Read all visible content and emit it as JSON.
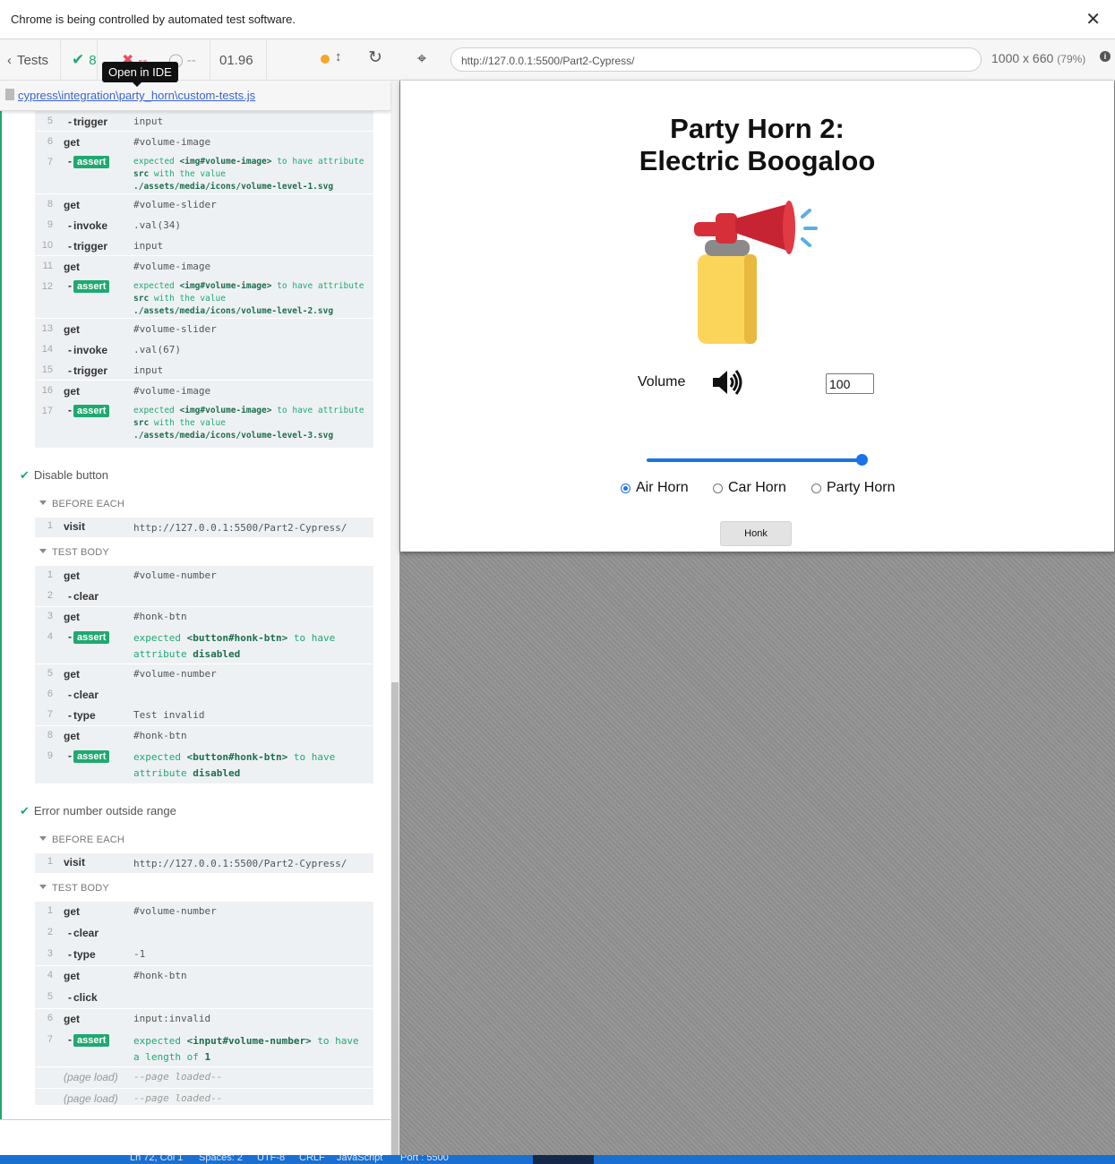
{
  "infobar": {
    "message": "Chrome is being controlled by automated test software.",
    "close": "✕"
  },
  "stats": {
    "tests_label": "Tests",
    "passed": "8",
    "failed": "--",
    "pending": "--",
    "duration": "01.96"
  },
  "tooltip": "Open in IDE",
  "file": {
    "path": "cypress\\integration\\party_horn\\custom-tests.js"
  },
  "commands_top": [
    {
      "num": "5",
      "cmd": "trigger",
      "sub": true,
      "msg": "input"
    },
    {
      "num": "6",
      "cmd": "get",
      "sub": false,
      "msg": "#volume-image"
    },
    {
      "num": "7",
      "assert": true,
      "line1": "expected",
      "el": "<img#volume-image>",
      "line1b": "to have attribute",
      "line2a": "src",
      "line2b": "with the value",
      "line3": "./assets/media/icons/volume-level-1.svg"
    },
    {
      "num": "8",
      "cmd": "get",
      "sub": false,
      "msg": "#volume-slider"
    },
    {
      "num": "9",
      "cmd": "invoke",
      "sub": true,
      "msg": ".val(34)"
    },
    {
      "num": "10",
      "cmd": "trigger",
      "sub": true,
      "msg": "input"
    },
    {
      "num": "11",
      "cmd": "get",
      "sub": false,
      "msg": "#volume-image"
    },
    {
      "num": "12",
      "assert": true,
      "line1": "expected",
      "el": "<img#volume-image>",
      "line1b": "to have attribute",
      "line2a": "src",
      "line2b": "with the value",
      "line3": "./assets/media/icons/volume-level-2.svg"
    },
    {
      "num": "13",
      "cmd": "get",
      "sub": false,
      "msg": "#volume-slider"
    },
    {
      "num": "14",
      "cmd": "invoke",
      "sub": true,
      "msg": ".val(67)"
    },
    {
      "num": "15",
      "cmd": "trigger",
      "sub": true,
      "msg": "input"
    },
    {
      "num": "16",
      "cmd": "get",
      "sub": false,
      "msg": "#volume-image"
    },
    {
      "num": "17",
      "assert": true,
      "line1": "expected",
      "el": "<img#volume-image>",
      "line1b": "to have attribute",
      "line2a": "src",
      "line2b": "with the value",
      "line3": "./assets/media/icons/volume-level-3.svg"
    }
  ],
  "test2": {
    "title": "Disable button",
    "before_each": "BEFORE EACH",
    "test_body": "TEST BODY",
    "visit": {
      "num": "1",
      "cmd": "visit",
      "msg": "http://127.0.0.1:5500/Part2-Cypress/"
    },
    "rows": [
      {
        "num": "1",
        "cmd": "get",
        "msg": "#volume-number"
      },
      {
        "num": "2",
        "cmd": "clear",
        "msg": ""
      },
      {
        "num": "3",
        "cmd": "get",
        "msg": "#honk-btn"
      },
      {
        "num": "4",
        "expected": "expected",
        "el": "<button#honk-btn>",
        "to": "to have",
        "attr": "attribute",
        "val": "disabled"
      },
      {
        "num": "5",
        "cmd": "get",
        "msg": "#volume-number"
      },
      {
        "num": "6",
        "cmd": "clear",
        "msg": ""
      },
      {
        "num": "7",
        "cmd": "type",
        "msg": "Test invalid"
      },
      {
        "num": "8",
        "cmd": "get",
        "msg": "#honk-btn"
      },
      {
        "num": "9",
        "expected": "expected",
        "el": "<button#honk-btn>",
        "to": "to have",
        "attr": "attribute",
        "val": "disabled"
      }
    ]
  },
  "test3": {
    "title": "Error number outside range",
    "before_each": "BEFORE EACH",
    "test_body": "TEST BODY",
    "visit": {
      "num": "1",
      "cmd": "visit",
      "msg": "http://127.0.0.1:5500/Part2-Cypress/"
    },
    "rows": [
      {
        "num": "1",
        "cmd": "get",
        "msg": "#volume-number"
      },
      {
        "num": "2",
        "cmd": "clear",
        "msg": ""
      },
      {
        "num": "3",
        "cmd": "type",
        "msg": "-1"
      },
      {
        "num": "4",
        "cmd": "get",
        "msg": "#honk-btn"
      },
      {
        "num": "5",
        "cmd": "click",
        "msg": ""
      },
      {
        "num": "6",
        "cmd": "get",
        "msg": "input:invalid"
      },
      {
        "num": "7",
        "expected": "expected",
        "el": "<input#volume-number>",
        "to": "to have",
        "attr": "a length of",
        "val": "1"
      },
      {
        "cmd": "(page load)",
        "msg": "--page loaded--"
      },
      {
        "cmd": "(page load)",
        "msg": "--page loaded--"
      }
    ]
  },
  "assert_label": "assert",
  "autbar": {
    "url": "http://127.0.0.1:5500/Part2-Cypress/",
    "viewport": "1000 x 660",
    "scale": "(79%)"
  },
  "app": {
    "title_line1": "Party Horn 2:",
    "title_line2": "Electric Boogaloo",
    "volume_label": "Volume",
    "volume_value": "100",
    "slider_fraction": 1.0,
    "radios": [
      "Air Horn",
      "Car Horn",
      "Party Horn"
    ],
    "selected_radio": "Air Horn",
    "honk": "Honk"
  },
  "taskbar": [
    "Ln 72, Col 1",
    "Spaces: 2",
    "UTF-8",
    "CRLF",
    "JavaScript",
    "Port : 5500"
  ],
  "colors": {
    "pass": "#1fa971",
    "accent": "#1a73e8",
    "fail": "#e94f5f"
  }
}
